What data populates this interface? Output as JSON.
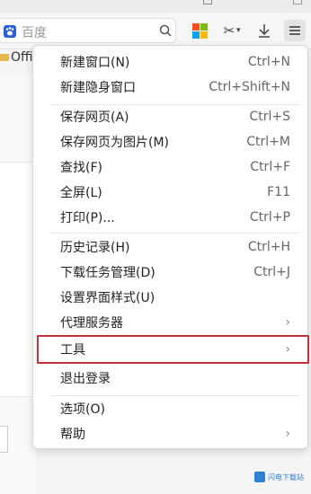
{
  "toolbar": {
    "address_placeholder": "百度",
    "icons": [
      "baidu-paw-icon",
      "search-icon",
      "microsoft-icon",
      "scissors-icon",
      "download-icon",
      "menu-icon"
    ]
  },
  "bookmarks": {
    "first": "Offi"
  },
  "menu": {
    "groups": [
      [
        {
          "label": "新建窗口(N)",
          "shortcut": "Ctrl+N"
        },
        {
          "label": "新建隐身窗口",
          "shortcut": "Ctrl+Shift+N"
        }
      ],
      [
        {
          "label": "保存网页(A)",
          "shortcut": "Ctrl+S"
        },
        {
          "label": "保存网页为图片(M)",
          "shortcut": "Ctrl+M"
        },
        {
          "label": "查找(F)",
          "shortcut": "Ctrl+F"
        },
        {
          "label": "全屏(L)",
          "shortcut": "F11"
        },
        {
          "label": "打印(P)...",
          "shortcut": "Ctrl+P"
        }
      ],
      [
        {
          "label": "历史记录(H)",
          "shortcut": "Ctrl+H"
        },
        {
          "label": "下载任务管理(D)",
          "shortcut": "Ctrl+J"
        },
        {
          "label": "设置界面样式(U)",
          "shortcut": ""
        },
        {
          "label": "代理服务器",
          "submenu": true
        },
        {
          "label": "工具",
          "submenu": true,
          "highlighted": true
        },
        {
          "label": "退出登录",
          "shortcut": ""
        }
      ],
      [
        {
          "label": "选项(O)",
          "shortcut": ""
        },
        {
          "label": "帮助",
          "submenu": true
        }
      ]
    ],
    "highlight_color": "#c2323a"
  },
  "watermark": {
    "text": "闪电下载站"
  }
}
